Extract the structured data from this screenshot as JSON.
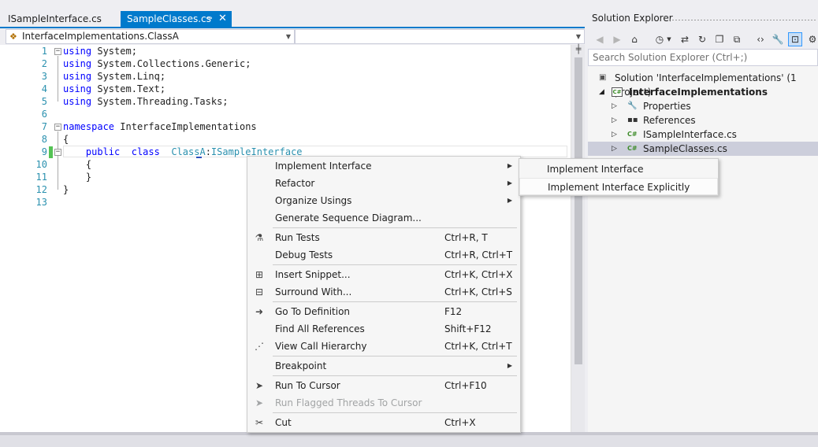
{
  "tabs": [
    {
      "label": "ISampleInterface.cs",
      "active": false
    },
    {
      "label": "SampleClasses.cs",
      "active": true
    }
  ],
  "navbar": {
    "type_combo": "InterfaceImplementations.ClassA",
    "member_combo": ""
  },
  "code_lines": [
    {
      "n": "1",
      "parts": [
        [
          "kw",
          "using"
        ],
        [
          "",
          "System;"
        ]
      ]
    },
    {
      "n": "2",
      "parts": [
        [
          "kw",
          "using"
        ],
        [
          "",
          "System.Collections.Generic;"
        ]
      ]
    },
    {
      "n": "3",
      "parts": [
        [
          "kw",
          "using"
        ],
        [
          "",
          "System.Linq;"
        ]
      ]
    },
    {
      "n": "4",
      "parts": [
        [
          "kw",
          "using"
        ],
        [
          "",
          "System.Text;"
        ]
      ]
    },
    {
      "n": "5",
      "parts": [
        [
          "kw",
          "using"
        ],
        [
          "",
          "System.Threading.Tasks;"
        ]
      ]
    },
    {
      "n": "6",
      "parts": []
    },
    {
      "n": "7",
      "parts": [
        [
          "kw",
          "namespace"
        ],
        [
          "",
          "InterfaceImplementations"
        ]
      ]
    },
    {
      "n": "8",
      "parts": [
        [
          "",
          "{"
        ]
      ]
    },
    {
      "n": "9",
      "parts": [
        [
          "",
          "    "
        ],
        [
          "kw",
          "public"
        ],
        [
          "",
          ""
        ],
        [
          "kw",
          "class"
        ],
        [
          "",
          ""
        ],
        [
          "ty",
          "ClassA"
        ],
        [
          "",
          ":"
        ],
        [
          "ty",
          "ISampleInterface"
        ]
      ]
    },
    {
      "n": "10",
      "parts": [
        [
          "",
          "    {"
        ]
      ]
    },
    {
      "n": "11",
      "parts": [
        [
          "",
          "    }"
        ]
      ]
    },
    {
      "n": "12",
      "parts": [
        [
          "",
          "}"
        ]
      ]
    },
    {
      "n": "13",
      "parts": []
    }
  ],
  "solution_explorer": {
    "title": "Solution Explorer",
    "search_placeholder": "Search Solution Explorer (Ctrl+;)",
    "toolbar_icons": [
      "back-icon",
      "forward-icon",
      "home-icon",
      "history-icon",
      "dropdown-icon",
      "sync-icon",
      "refresh-icon",
      "collapse-icon",
      "show-all-files-icon",
      "view-code-icon",
      "properties-icon",
      "preview-icon",
      "class-view-icon"
    ],
    "tree": [
      {
        "label": "Solution 'InterfaceImplementations' (1 project)",
        "level": 0,
        "kind": "solution"
      },
      {
        "label": "InterfaceImplementations",
        "level": 1,
        "kind": "project",
        "bold": true
      },
      {
        "label": "Properties",
        "level": 2,
        "kind": "properties"
      },
      {
        "label": "References",
        "level": 2,
        "kind": "references"
      },
      {
        "label": "ISampleInterface.cs",
        "level": 2,
        "kind": "cs"
      },
      {
        "label": "SampleClasses.cs",
        "level": 2,
        "kind": "cs",
        "selected": true
      }
    ],
    "cs_badge": "C#"
  },
  "context_menu": {
    "items": [
      {
        "label": "Implement Interface",
        "submenu": true,
        "icon": ""
      },
      {
        "label": "Refactor",
        "submenu": true,
        "icon": ""
      },
      {
        "label": "Organize Usings",
        "submenu": true,
        "icon": ""
      },
      {
        "label": "Generate Sequence Diagram...",
        "icon": ""
      },
      {
        "sep": true
      },
      {
        "label": "Run Tests",
        "shortcut": "Ctrl+R, T",
        "icon": "run-tests-icon"
      },
      {
        "label": "Debug Tests",
        "shortcut": "Ctrl+R, Ctrl+T",
        "icon": ""
      },
      {
        "sep": true
      },
      {
        "label": "Insert Snippet...",
        "shortcut": "Ctrl+K, Ctrl+X",
        "icon": "snippet-icon"
      },
      {
        "label": "Surround With...",
        "shortcut": "Ctrl+K, Ctrl+S",
        "icon": "surround-icon"
      },
      {
        "sep": true
      },
      {
        "label": "Go To Definition",
        "shortcut": "F12",
        "icon": "goto-definition-icon"
      },
      {
        "label": "Find All References",
        "shortcut": "Shift+F12",
        "icon": ""
      },
      {
        "label": "View Call Hierarchy",
        "shortcut": "Ctrl+K, Ctrl+T",
        "icon": "call-hierarchy-icon"
      },
      {
        "sep": true
      },
      {
        "label": "Breakpoint",
        "submenu": true,
        "icon": ""
      },
      {
        "sep": true
      },
      {
        "label": "Run To Cursor",
        "shortcut": "Ctrl+F10",
        "icon": "cursor-icon"
      },
      {
        "label": "Run Flagged Threads To Cursor",
        "disabled": true,
        "icon": "cursor-icon"
      },
      {
        "sep": true
      },
      {
        "label": "Cut",
        "shortcut": "Ctrl+X",
        "icon": "cut-icon"
      }
    ]
  },
  "submenu": {
    "items": [
      "Implement Interface",
      "Implement Interface Explicitly"
    ]
  }
}
